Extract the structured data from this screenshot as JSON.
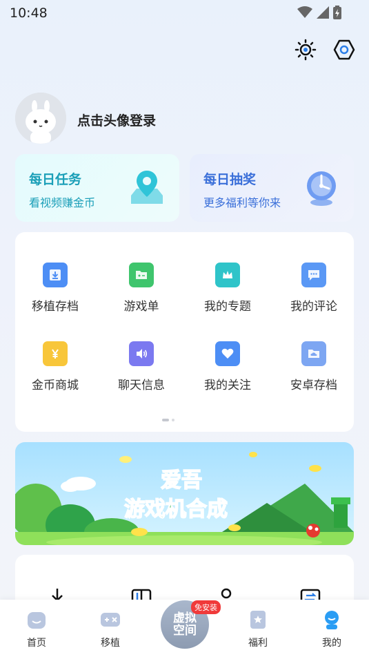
{
  "status": {
    "time": "10:48"
  },
  "profile": {
    "login_text": "点击头像登录"
  },
  "daily_task": {
    "title": "每日任务",
    "subtitle": "看视频赚金币"
  },
  "daily_draw": {
    "title": "每日抽奖",
    "subtitle": "更多福利等你来"
  },
  "grid": {
    "items": [
      {
        "label": "移植存档",
        "icon": "download-box-icon",
        "color": "#4d8ef5"
      },
      {
        "label": "游戏单",
        "icon": "gamepad-folder-icon",
        "color": "#3fc56d"
      },
      {
        "label": "我的专题",
        "icon": "crown-icon",
        "color": "#2fc4c9"
      },
      {
        "label": "我的评论",
        "icon": "comment-icon",
        "color": "#5a98f5"
      },
      {
        "label": "金币商城",
        "icon": "yen-icon",
        "color": "#f8c63a"
      },
      {
        "label": "聊天信息",
        "icon": "speaker-icon",
        "color": "#7b79f0"
      },
      {
        "label": "我的关注",
        "icon": "heart-icon",
        "color": "#4d8ef5"
      },
      {
        "label": "安卓存档",
        "icon": "cloud-folder-icon",
        "color": "#7da6f2"
      }
    ],
    "page_count": 2,
    "active_page": 1
  },
  "banner": {
    "line1": "爱吾",
    "line2": "游戏机合成"
  },
  "tabbar": {
    "home": "首页",
    "port": "移植",
    "center_line1": "虚拟",
    "center_line2": "空间",
    "center_badge": "免安装",
    "welfare": "福利",
    "mine": "我的"
  },
  "colors": {
    "accent": "#1f7be0",
    "task": "#1b9fb8",
    "draw": "#3a6fd9",
    "active_tab": "#2a9df4"
  }
}
